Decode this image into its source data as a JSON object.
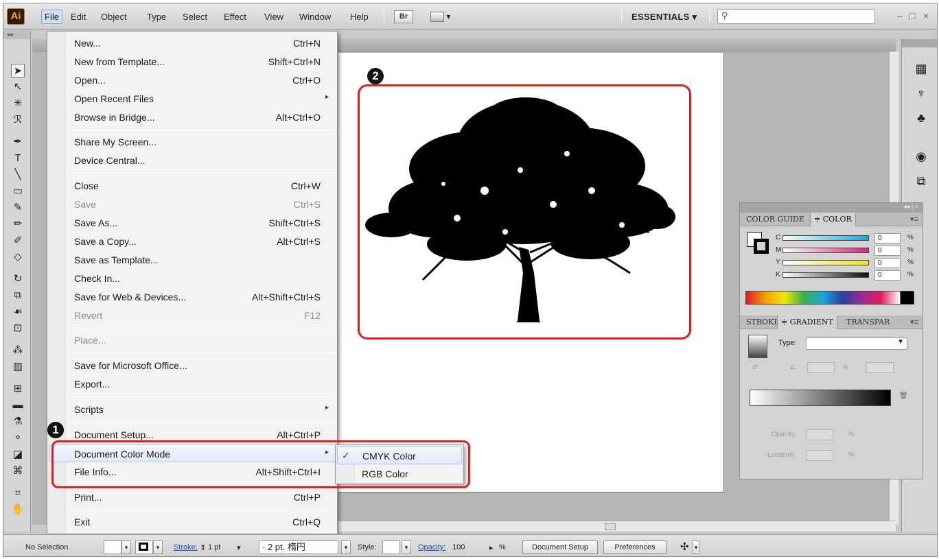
{
  "app": {
    "logo": "Ai",
    "menus": [
      {
        "label": "File"
      },
      {
        "label": "Edit"
      },
      {
        "label": "Object"
      },
      {
        "label": "Type"
      },
      {
        "label": "Select"
      },
      {
        "label": "Effect"
      },
      {
        "label": "View"
      },
      {
        "label": "Window"
      },
      {
        "label": "Help"
      }
    ],
    "bridge_button": "Br",
    "workspace": "ESSENTIALS ▾",
    "search_placeholder": "",
    "window_controls": {
      "minimize": "–",
      "maximize": "□",
      "close": "×"
    }
  },
  "file_menu": {
    "items": [
      {
        "label": "New...",
        "shortcut": "Ctrl+N"
      },
      {
        "label": "New from Template...",
        "shortcut": "Shift+Ctrl+N"
      },
      {
        "label": "Open...",
        "shortcut": "Ctrl+O"
      },
      {
        "label": "Open Recent Files",
        "shortcut": "▸"
      },
      {
        "label": "Browse in Bridge...",
        "shortcut": "Alt+Ctrl+O"
      },
      {
        "label": "Share My Screen...",
        "shortcut": ""
      },
      {
        "label": "Device Central...",
        "shortcut": ""
      },
      {
        "label": "Close",
        "shortcut": "Ctrl+W"
      },
      {
        "label": "Save",
        "shortcut": "Ctrl+S"
      },
      {
        "label": "Save As...",
        "shortcut": "Shift+Ctrl+S"
      },
      {
        "label": "Save a Copy...",
        "shortcut": "Alt+Ctrl+S"
      },
      {
        "label": "Save as Template...",
        "shortcut": ""
      },
      {
        "label": "Check In...",
        "shortcut": ""
      },
      {
        "label": "Save for Web & Devices...",
        "shortcut": "Alt+Shift+Ctrl+S"
      },
      {
        "label": "Revert",
        "shortcut": "F12"
      },
      {
        "label": "Place...",
        "shortcut": ""
      },
      {
        "label": "Save for Microsoft Office...",
        "shortcut": ""
      },
      {
        "label": "Export...",
        "shortcut": ""
      },
      {
        "label": "Scripts",
        "shortcut": "▸"
      },
      {
        "label": "Document Setup...",
        "shortcut": "Alt+Ctrl+P"
      },
      {
        "label": "Document Color Mode",
        "shortcut": "▸"
      },
      {
        "label": "File Info...",
        "shortcut": "Alt+Shift+Ctrl+I"
      },
      {
        "label": "Print...",
        "shortcut": "Ctrl+P"
      },
      {
        "label": "Exit",
        "shortcut": "Ctrl+Q"
      }
    ]
  },
  "color_mode_submenu": {
    "check": "✓",
    "items": [
      {
        "label": "CMYK Color"
      },
      {
        "label": "RGB Color"
      }
    ]
  },
  "callouts": {
    "one": "1",
    "two": "2"
  },
  "color_panel": {
    "tabs": [
      "COLOR GUIDE",
      "≑ COLOR"
    ],
    "channels": [
      {
        "name": "C",
        "value": "0",
        "unit": "%",
        "color": "#17a6d8"
      },
      {
        "name": "M",
        "value": "0",
        "unit": "%",
        "color": "#d8247a"
      },
      {
        "name": "Y",
        "value": "0",
        "unit": "%",
        "color": "#f2e21a"
      },
      {
        "name": "K",
        "value": "0",
        "unit": "%",
        "color": "#111111"
      }
    ],
    "top_controls": "◂◂ | ×"
  },
  "gradient_panel": {
    "tabs": [
      "STROKE",
      "≑ GRADIENT",
      "TRANSPAR"
    ],
    "type_label": "Type:",
    "opacity_label": "Opacity:",
    "location_label": "Location:",
    "percent": "%"
  },
  "control_bar": {
    "selection": "No Selection",
    "stroke_label": "Stroke:",
    "stroke_value": "1 pt",
    "brush": "· 2 pt. 楕円",
    "style_label": "Style:",
    "opacity_label": "Opacity:",
    "opacity_value": "100",
    "percent": "%",
    "document_setup": "Document Setup",
    "preferences": "Preferences"
  }
}
